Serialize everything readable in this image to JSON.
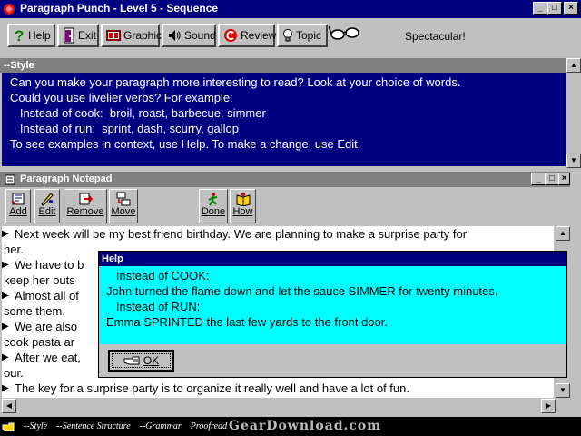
{
  "window": {
    "title": "Paragraph Punch - Level 5 - Sequence"
  },
  "toolbar": {
    "buttons": [
      {
        "label": "Help"
      },
      {
        "label": "Exit"
      },
      {
        "label": "Graphic"
      },
      {
        "label": "Sound"
      },
      {
        "label": "Review"
      },
      {
        "label": "Topic"
      }
    ],
    "status_message": "Spectacular!"
  },
  "style_panel": {
    "caption": "--Style",
    "lines": [
      "Can you make your paragraph more interesting to read? Look at your choice of words.",
      "Could you use livelier verbs? For example:",
      "   Instead of cook:  broil, roast, barbecue, simmer",
      "   Instead of run:  sprint, dash, scurry, gallop",
      "",
      "To see examples in context, use Help. To make a change, use Edit."
    ]
  },
  "notepad": {
    "caption": "Paragraph Notepad",
    "buttons": [
      {
        "label": "Add",
        "icon": "add-icon"
      },
      {
        "label": "Edit",
        "icon": "edit-icon"
      },
      {
        "label": "Remove",
        "icon": "remove-icon"
      },
      {
        "label": "Move",
        "icon": "move-icon"
      },
      {
        "label": "Done",
        "icon": "done-icon"
      },
      {
        "label": "How",
        "icon": "how-icon"
      }
    ],
    "paragraphs": [
      [
        "Next week will be my best friend birthday. We are planning to make a surprise party for",
        "her."
      ],
      [
        "We have to b",
        "keep her outs"
      ],
      [
        "Almost all of",
        "some them."
      ],
      [
        "We are also",
        "cook pasta ar"
      ],
      [
        "After we eat,",
        "our."
      ],
      [
        "The key for a surprise party is to organize it really well and have a lot of fun."
      ]
    ]
  },
  "help_dialog": {
    "caption": "Help",
    "lines": [
      "   Instead of COOK:",
      "John turned the flame down and let the sauce SIMMER for twenty minutes.",
      "",
      "   Instead of RUN:",
      "Emma SPRINTED the last few yards to the front door."
    ],
    "ok_label": "OK"
  },
  "bottom_bar": {
    "items": [
      "--Style",
      "--Sentence Structure",
      "--Grammar",
      "Proofread"
    ]
  },
  "watermark": "GearDownload.com",
  "colors": {
    "title_bar": "#000080",
    "help_body": "#00ffff",
    "panel_caption": "#808080"
  }
}
